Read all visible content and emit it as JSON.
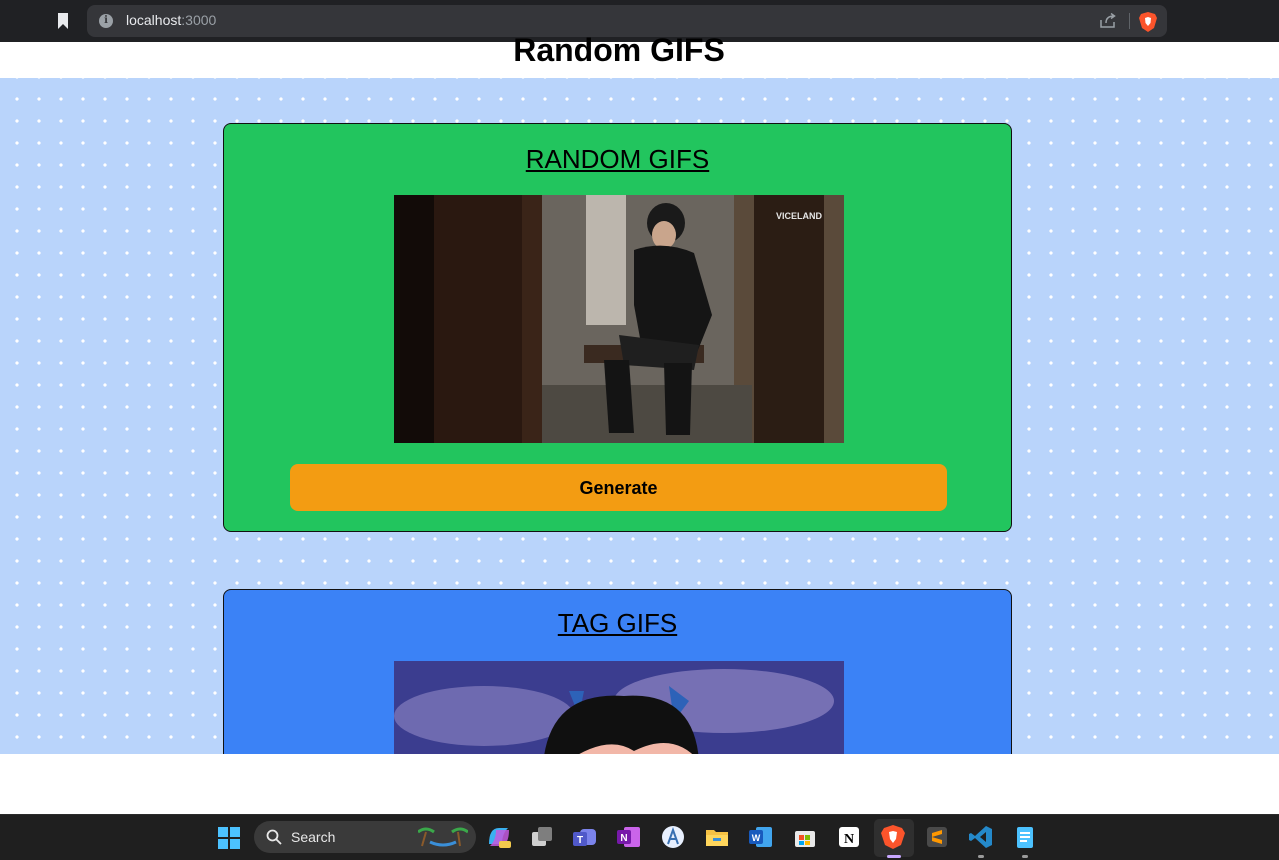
{
  "browser": {
    "url_host": "localhost",
    "url_port": ":3000"
  },
  "page": {
    "title": "Random GIFS"
  },
  "random_card": {
    "title": "RANDOM GIFS",
    "gif_watermark": "VICELAND",
    "button_label": "Generate"
  },
  "tag_card": {
    "title": "TAG GIFS"
  },
  "taskbar": {
    "search_label": "Search",
    "apps": [
      "copilot-icon",
      "task-view-icon",
      "teams-icon",
      "onenote-icon",
      "android-studio-icon",
      "file-explorer-icon",
      "word-icon",
      "store-icon",
      "notion-icon",
      "brave-icon",
      "sublime-text-icon",
      "vscode-icon",
      "notepad-icon"
    ]
  },
  "colors": {
    "random_card_bg": "#22c55e",
    "tag_card_bg": "#3b82f6",
    "button_bg": "#f39c12",
    "page_pattern_bg": "#b9d4fb"
  }
}
